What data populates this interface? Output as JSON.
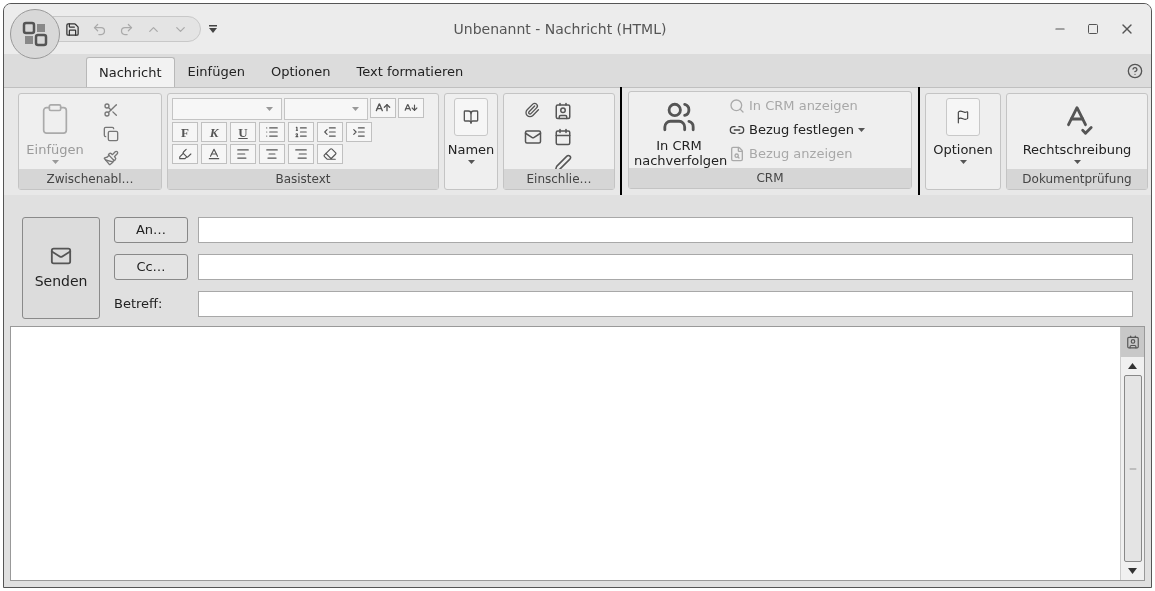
{
  "window": {
    "title": "Unbenannt - Nachricht (HTML)"
  },
  "tabs": [
    {
      "label": "Nachricht",
      "selected": true
    },
    {
      "label": "Einfügen",
      "selected": false
    },
    {
      "label": "Optionen",
      "selected": false
    },
    {
      "label": "Text formatieren",
      "selected": false
    }
  ],
  "ribbon": {
    "groups": [
      {
        "kind": "clipboard",
        "label": "Zwischenabl…",
        "paste": {
          "label": "Einfügen",
          "disabled": true
        }
      },
      {
        "kind": "basic_text",
        "label": "Basistext",
        "format_buttons": [
          "F",
          "K",
          "U"
        ]
      },
      {
        "kind": "names",
        "button": "Namen"
      },
      {
        "kind": "include",
        "label": "Einschlie…"
      },
      {
        "kind": "crm",
        "label": "CRM",
        "highlighted": true,
        "main_button": "In CRM nachverfolgen",
        "items": [
          {
            "label": "In CRM anzeigen",
            "disabled": true,
            "dropdown": false
          },
          {
            "label": "Bezug festlegen",
            "disabled": false,
            "dropdown": true
          },
          {
            "label": "Bezug anzeigen",
            "disabled": true,
            "dropdown": false
          }
        ]
      },
      {
        "kind": "options",
        "button": "Optionen"
      },
      {
        "kind": "proofing",
        "label": "Dokumentprüfung",
        "button": "Rechtschreibung"
      }
    ]
  },
  "send_button": {
    "label": "Senden"
  },
  "header_fields": [
    {
      "kind": "button",
      "label": "An…"
    },
    {
      "kind": "button",
      "label": "Cc…"
    },
    {
      "kind": "label",
      "label": "Betreff:"
    }
  ]
}
